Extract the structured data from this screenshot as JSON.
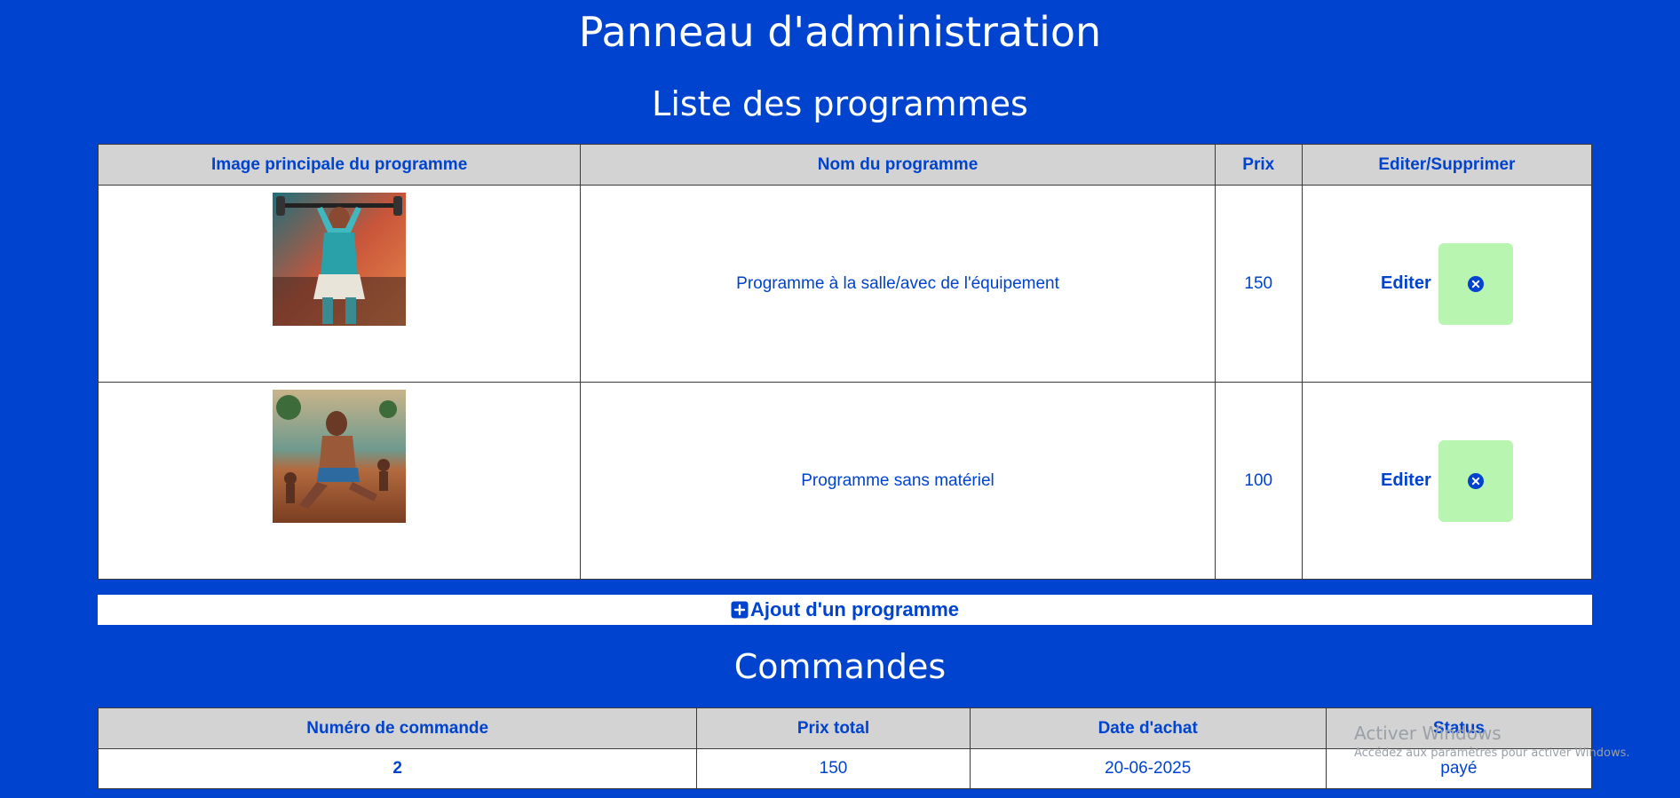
{
  "page": {
    "title": "Panneau d'administration"
  },
  "programs": {
    "title": "Liste des programmes",
    "headers": {
      "image": "Image principale du programme",
      "name": "Nom du programme",
      "price": "Prix",
      "actions": "Editer/Supprimer"
    },
    "rows": [
      {
        "name": "Programme à la salle/avec de l'équipement",
        "price": "150",
        "edit_label": "Editer",
        "image": "gym-weightlifter-image"
      },
      {
        "name": "Programme sans matériel",
        "price": "100",
        "edit_label": "Editer",
        "image": "outdoor-bodyweight-image"
      }
    ],
    "add_label": "Ajout d'un programme"
  },
  "orders": {
    "title": "Commandes",
    "headers": {
      "number": "Numéro de commande",
      "total": "Prix total",
      "date": "Date d'achat",
      "status": "Status"
    },
    "rows": [
      {
        "number": "2",
        "total": "150",
        "date": "20-06-2025",
        "status": "payé"
      }
    ]
  },
  "watermark": {
    "title": "Activer Windows",
    "subtitle": "Accédez aux paramètres pour activer Windows."
  },
  "colors": {
    "background": "#0043CE",
    "header_bg": "#D3D3D3",
    "delete_button_bg": "#B8F5B0"
  },
  "icons": {
    "delete": "close-circle-icon",
    "add": "plus-square-icon"
  }
}
